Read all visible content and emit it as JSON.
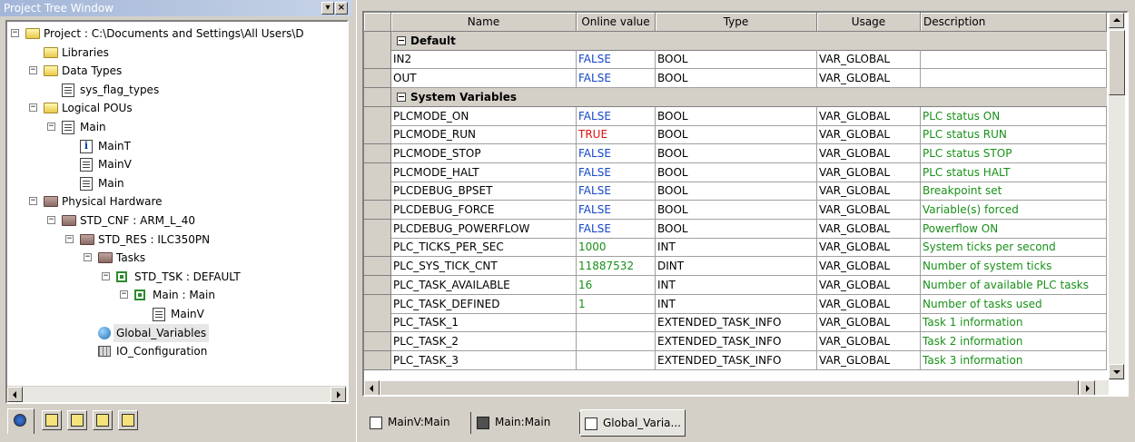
{
  "left": {
    "title": "Project Tree Window",
    "min_glyph": "▾",
    "close_glyph": "×",
    "tree": [
      {
        "label": "Project : C:\\Documents and Settings\\All Users\\D",
        "icon": "folder-icon"
      },
      {
        "label": "Libraries",
        "icon": "folder-icon"
      },
      {
        "label": "Data Types",
        "icon": "folder-icon"
      },
      {
        "label": "sys_flag_types",
        "icon": "datatype-icon"
      },
      {
        "label": "Logical POUs",
        "icon": "folder-icon"
      },
      {
        "label": "Main",
        "icon": "program-icon"
      },
      {
        "label": "MainT",
        "icon": "info-icon"
      },
      {
        "label": "MainV",
        "icon": "variables-icon"
      },
      {
        "label": "Main",
        "icon": "code-icon"
      },
      {
        "label": "Physical Hardware",
        "icon": "hardware-folder-icon"
      },
      {
        "label": "STD_CNF : ARM_L_40",
        "icon": "hardware-folder-icon"
      },
      {
        "label": "STD_RES : ILC350PN",
        "icon": "hardware-folder-icon"
      },
      {
        "label": "Tasks",
        "icon": "hardware-folder-icon"
      },
      {
        "label": "STD_TSK : DEFAULT",
        "icon": "task-icon"
      },
      {
        "label": "Main : Main",
        "icon": "task-icon"
      },
      {
        "label": "MainV",
        "icon": "variables-icon"
      },
      {
        "label": "Global_Variables",
        "icon": "globe-icon"
      },
      {
        "label": "IO_Configuration",
        "icon": "io-config-icon"
      }
    ],
    "selected_index": 16
  },
  "grid": {
    "columns": [
      "Name",
      "Online value",
      "Type",
      "Usage",
      "Description"
    ],
    "groups": [
      {
        "label": "Default",
        "rows": [
          {
            "name": "IN2",
            "value": "FALSE",
            "vkind": "false",
            "type": "BOOL",
            "usage": "VAR_GLOBAL",
            "desc": ""
          },
          {
            "name": "OUT",
            "value": "FALSE",
            "vkind": "false",
            "type": "BOOL",
            "usage": "VAR_GLOBAL",
            "desc": ""
          }
        ]
      },
      {
        "label": "System Variables",
        "rows": [
          {
            "name": "PLCMODE_ON",
            "value": "FALSE",
            "vkind": "false",
            "type": "BOOL",
            "usage": "VAR_GLOBAL",
            "desc": "PLC status ON"
          },
          {
            "name": "PLCMODE_RUN",
            "value": "TRUE",
            "vkind": "true",
            "type": "BOOL",
            "usage": "VAR_GLOBAL",
            "desc": "PLC status RUN"
          },
          {
            "name": "PLCMODE_STOP",
            "value": "FALSE",
            "vkind": "false",
            "type": "BOOL",
            "usage": "VAR_GLOBAL",
            "desc": "PLC status STOP"
          },
          {
            "name": "PLCMODE_HALT",
            "value": "FALSE",
            "vkind": "false",
            "type": "BOOL",
            "usage": "VAR_GLOBAL",
            "desc": "PLC status HALT"
          },
          {
            "name": "PLCDEBUG_BPSET",
            "value": "FALSE",
            "vkind": "false",
            "type": "BOOL",
            "usage": "VAR_GLOBAL",
            "desc": "Breakpoint set"
          },
          {
            "name": "PLCDEBUG_FORCE",
            "value": "FALSE",
            "vkind": "false",
            "type": "BOOL",
            "usage": "VAR_GLOBAL",
            "desc": "Variable(s) forced"
          },
          {
            "name": "PLCDEBUG_POWERFLOW",
            "value": "FALSE",
            "vkind": "false",
            "type": "BOOL",
            "usage": "VAR_GLOBAL",
            "desc": "Powerflow ON"
          },
          {
            "name": "PLC_TICKS_PER_SEC",
            "value": "1000",
            "vkind": "num",
            "type": "INT",
            "usage": "VAR_GLOBAL",
            "desc": "System ticks per second"
          },
          {
            "name": "PLC_SYS_TICK_CNT",
            "value": "11887532",
            "vkind": "num",
            "type": "DINT",
            "usage": "VAR_GLOBAL",
            "desc": "Number of system ticks"
          },
          {
            "name": "PLC_TASK_AVAILABLE",
            "value": "16",
            "vkind": "num",
            "type": "INT",
            "usage": "VAR_GLOBAL",
            "desc": "Number of available PLC tasks"
          },
          {
            "name": "PLC_TASK_DEFINED",
            "value": "1",
            "vkind": "num",
            "type": "INT",
            "usage": "VAR_GLOBAL",
            "desc": "Number of tasks used"
          },
          {
            "name": "PLC_TASK_1",
            "value": "",
            "vkind": "num",
            "type": "EXTENDED_TASK_INFO",
            "usage": "VAR_GLOBAL",
            "desc": "Task 1 information"
          },
          {
            "name": "PLC_TASK_2",
            "value": "",
            "vkind": "num",
            "type": "EXTENDED_TASK_INFO",
            "usage": "VAR_GLOBAL",
            "desc": "Task 2 information"
          },
          {
            "name": "PLC_TASK_3",
            "value": "",
            "vkind": "num",
            "type": "EXTENDED_TASK_INFO",
            "usage": "VAR_GLOBAL",
            "desc": "Task 3 information"
          }
        ]
      }
    ]
  },
  "bottom_tabs": [
    {
      "label": "MainV:Main",
      "icon": "variables-icon"
    },
    {
      "label": "Main:Main",
      "icon": "function-block-icon"
    },
    {
      "label": "Global_Varia...",
      "icon": "variables-icon"
    }
  ],
  "active_bottom_tab": 2,
  "colors": {
    "false_value": "#1446c8",
    "true_value": "#e01010",
    "numeric_value": "#189018",
    "description": "#189018"
  }
}
